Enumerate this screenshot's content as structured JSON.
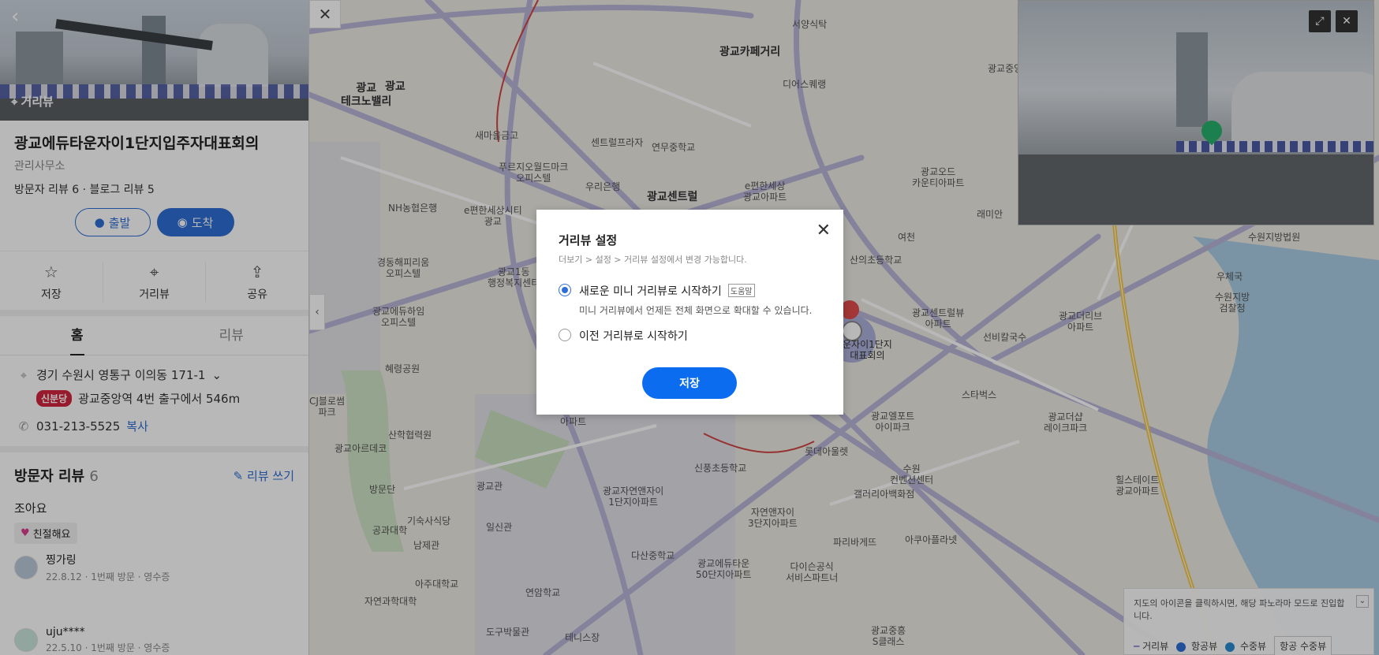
{
  "panel": {
    "hero_tag": "거리뷰",
    "title": "광교에듀타운자이1단지입주자대표회의",
    "category": "관리사무소",
    "reviews_summary": "방문자 리뷰 6 · 블로그 리뷰 5",
    "start_label": "출발",
    "end_label": "도착",
    "actions": [
      {
        "label": "저장",
        "icon": "star-icon"
      },
      {
        "label": "거리뷰",
        "icon": "pin-icon"
      },
      {
        "label": "공유",
        "icon": "share-icon"
      }
    ],
    "tabs": [
      {
        "label": "홈"
      },
      {
        "label": "리뷰"
      }
    ],
    "address": "경기 수원시 영통구 이의동 171-1",
    "subway_line": "신분당",
    "subway_text": "광교중앙역 4번 출구에서 546m",
    "phone": "031-213-5525",
    "copy_label": "복사",
    "reviews_heading": "방문자 리뷰",
    "reviews_count": "6",
    "write_review": "리뷰 쓰기",
    "review_text": "조아요",
    "review_chip": "친절해요",
    "users": [
      {
        "name": "찡가링",
        "meta": "22.8.12 · 1번째 방문 · 영수증"
      },
      {
        "name": "uju****",
        "meta": "22.5.10 · 1번째 방문 · 영수증"
      }
    ]
  },
  "map": {
    "labels": [
      {
        "text": "광교카페거리"
      },
      {
        "text": "광교\n테크노밸리"
      },
      {
        "text": "서양식탁"
      },
      {
        "text": "새마을금고"
      },
      {
        "text": "센트럴프라자"
      },
      {
        "text": "연무중학교"
      },
      {
        "text": "푸르지오월드마크\n오피스텔"
      },
      {
        "text": "우리은행"
      },
      {
        "text": "NH농협은행"
      },
      {
        "text": "e편한세상시티\n광교"
      },
      {
        "text": "광교센트럴"
      },
      {
        "text": "e편한세상\n광교아파트"
      },
      {
        "text": "광교오드\n카운티아파트"
      },
      {
        "text": "산의초등학교"
      },
      {
        "text": "광교센트럴뷰\n아파트"
      },
      {
        "text": "광교더리브\n아파트"
      },
      {
        "text": "수원지방\n검찰청"
      },
      {
        "text": "우체국"
      },
      {
        "text": "수원지방법원"
      },
      {
        "text": "선비칼국수"
      },
      {
        "text": "스타벅스"
      },
      {
        "text": "광교엘포트\n아이파크"
      },
      {
        "text": "광교더샵\n레이크파크"
      },
      {
        "text": "롯데아울렛"
      },
      {
        "text": "신풍초등학교"
      },
      {
        "text": "갤러리아백화점"
      },
      {
        "text": "수원\n컨벤션센터"
      },
      {
        "text": "광교자연앤자이\n1단지아파트"
      },
      {
        "text": "자연앤자이\n3단지아파트"
      },
      {
        "text": "파리바게뜨"
      },
      {
        "text": "아쿠아플라넷"
      },
      {
        "text": "힐스테이트\n광교아파트"
      },
      {
        "text": "다산중학교"
      },
      {
        "text": "광교에듀타운\n50단지아파트"
      },
      {
        "text": "다이슨공식\n서비스파트너"
      },
      {
        "text": "광교중흥\nS클래스"
      },
      {
        "text": "경동해피리움\n오피스텔"
      },
      {
        "text": "광교1동\n행정복지센터"
      },
      {
        "text": "광교에듀하임\n오피스텔"
      },
      {
        "text": "혜령공원"
      },
      {
        "text": "CJ블로썸\n파크"
      },
      {
        "text": "광교아르데코"
      },
      {
        "text": "산학협력원"
      },
      {
        "text": "방문단"
      },
      {
        "text": "광교관"
      },
      {
        "text": "기숙사식당"
      },
      {
        "text": "일신관"
      },
      {
        "text": "공과대학"
      },
      {
        "text": "남제관"
      },
      {
        "text": "아주대학교"
      },
      {
        "text": "연암학교"
      },
      {
        "text": "자연과학대학"
      },
      {
        "text": "도구박물관"
      },
      {
        "text": "테니스장"
      },
      {
        "text": "여천"
      },
      {
        "text": "광교중앙"
      },
      {
        "text": "래미안"
      },
      {
        "text": "디어스퀘랭"
      },
      {
        "text": "운자이1단지\n대표회의"
      },
      {
        "text": "아파트"
      },
      {
        "text": "광교"
      }
    ],
    "legend_hint": "지도의 아이콘을 클릭하시면, 해당 파노라마 모드로 진입합니다.",
    "legend_items": [
      {
        "label": "거리뷰"
      },
      {
        "label": "항공뷰"
      },
      {
        "label": "수중뷰"
      }
    ],
    "legend_select": "항공 수중뷰"
  },
  "modal": {
    "title": "거리뷰 설정",
    "subtitle": "더보기 > 설정 > 거리뷰 설정에서 변경 가능합니다.",
    "option1": "새로운 미니 거리뷰로 시작하기",
    "option1_help": "도움말",
    "option1_desc": "미니 거리뷰에서 언제든 전체 화면으로 확대할 수 있습니다.",
    "option2": "이전 거리뷰로 시작하기",
    "save": "저장",
    "selected_option": 1
  },
  "colors": {
    "accent": "#2e6ed6",
    "save_button": "#0b6cf0",
    "subway_badge": "#d3253f"
  }
}
